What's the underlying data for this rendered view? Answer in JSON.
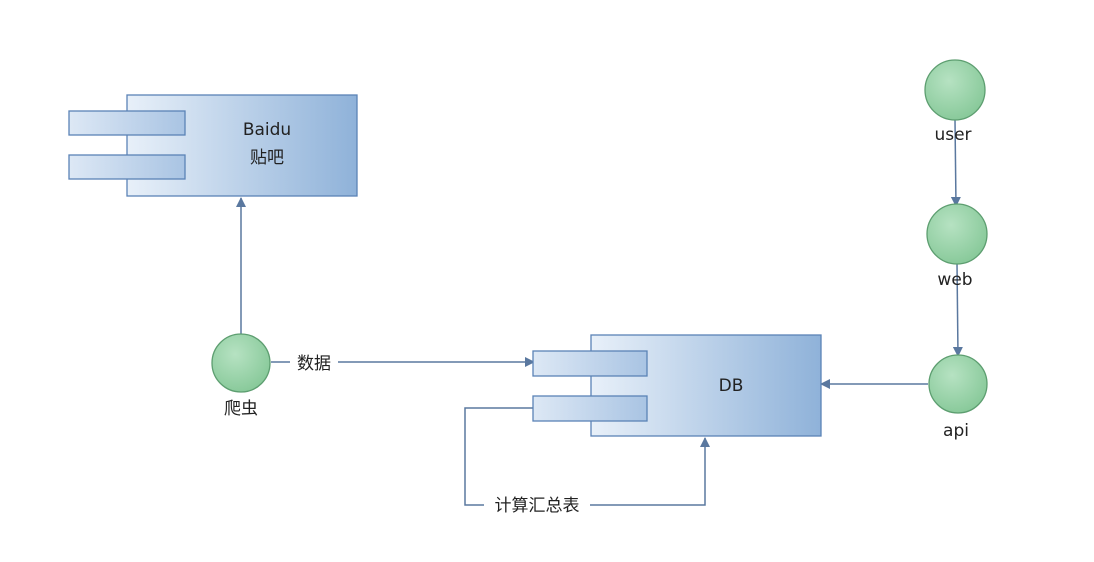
{
  "components": {
    "baidu": {
      "label_line1": "Baidu",
      "label_line2": "贴吧"
    },
    "db": {
      "label": "DB"
    }
  },
  "nodes": {
    "crawler": {
      "label": "爬虫"
    },
    "user": {
      "label": "user"
    },
    "web": {
      "label": "web"
    },
    "api": {
      "label": "api"
    }
  },
  "edges": {
    "crawler_to_db": {
      "label": "数据"
    },
    "db_self": {
      "label": "计算汇总表"
    }
  },
  "colors": {
    "component_fill_start": "#e6eef8",
    "component_fill_end": "#8fb2d9",
    "component_stroke": "#5b83b6",
    "node_fill": "#98d3a7",
    "node_stroke": "#5d9e70",
    "edge_color": "#5a789f"
  }
}
